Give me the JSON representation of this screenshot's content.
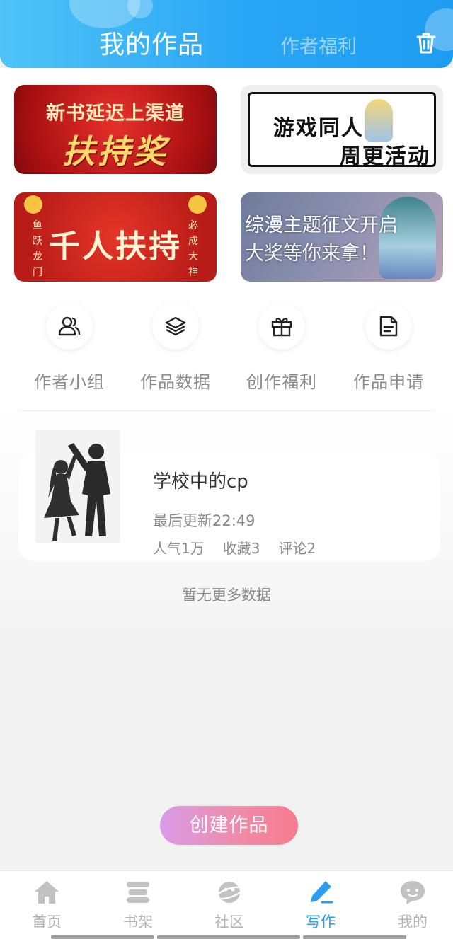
{
  "header": {
    "title": "我的作品",
    "tab_welfare": "作者福利",
    "trash_icon": "trash-icon"
  },
  "banners": [
    {
      "line1": "新书延迟上渠道",
      "line2": "扶持奖"
    },
    {
      "line1": "游戏同人",
      "line2": "周更活动"
    },
    {
      "main": "千人扶持",
      "left_vertical": "鱼跃龙门",
      "right_vertical": "必成大神"
    },
    {
      "line1": "综漫主题征文开启",
      "line2": "大奖等你来拿！"
    }
  ],
  "categories": [
    {
      "label": "作者小组",
      "icon": "users-icon"
    },
    {
      "label": "作品数据",
      "icon": "layers-icon"
    },
    {
      "label": "创作福利",
      "icon": "gift-icon"
    },
    {
      "label": "作品申请",
      "icon": "document-icon"
    }
  ],
  "work": {
    "title": "学校中的cp",
    "update": "最后更新22:49",
    "popularity": "人气1万",
    "favorites": "收藏3",
    "comments": "评论2"
  },
  "no_more": "暂无更多数据",
  "create_button": "创建作品",
  "nav": [
    {
      "label": "首页",
      "icon": "home-icon"
    },
    {
      "label": "书架",
      "icon": "bookshelf-icon"
    },
    {
      "label": "社区",
      "icon": "planet-icon"
    },
    {
      "label": "写作",
      "icon": "pen-icon",
      "active": true
    },
    {
      "label": "我的",
      "icon": "chat-face-icon"
    }
  ],
  "colors": {
    "header_start": "#4fc3f7",
    "header_end": "#1e9cf2",
    "active_nav": "#2d9cf1",
    "button_start": "#d99be8",
    "button_end": "#f77b8e"
  }
}
